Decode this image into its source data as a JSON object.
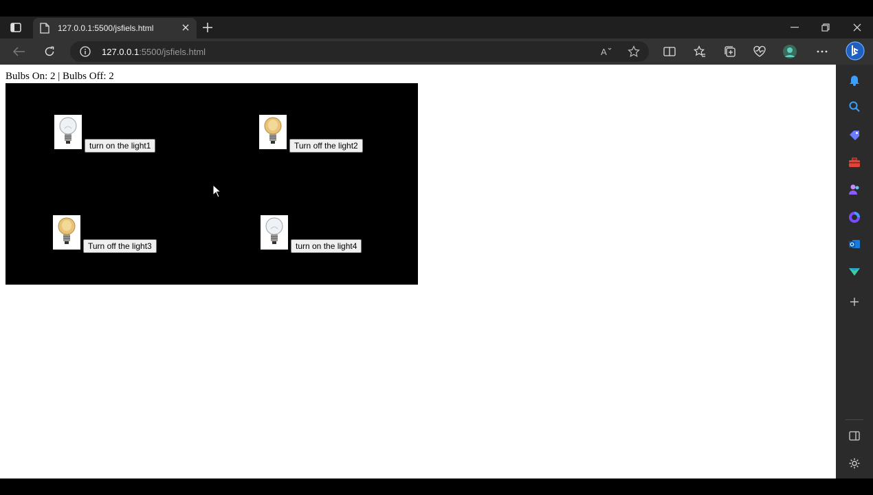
{
  "browser": {
    "tab_title": "127.0.0.1:5500/jsfiels.html",
    "url_host": "127.0.0.1",
    "url_rest": ":5500/jsfiels.html",
    "icons": {
      "tab_actions": "tab-actions-icon",
      "new_tab": "plus-icon",
      "back": "back-arrow-icon",
      "refresh": "refresh-icon",
      "site_info": "info-icon",
      "read_aloud": "read-aloud-icon",
      "favorite": "star-icon",
      "split_screen": "split-screen-icon",
      "favorites": "favorites-icon",
      "collections": "collections-icon",
      "health": "health-icon",
      "profile": "profile-avatar-icon",
      "more": "more-icon",
      "copilot": "bing-icon"
    },
    "sidebar_icons": [
      "bell-icon",
      "search-icon",
      "tag-icon",
      "toolbox-icon",
      "people-icon",
      "circle-app-icon",
      "outlook-icon",
      "send-icon",
      "plus-icon",
      "sidebar-toggle-icon",
      "gear-icon"
    ],
    "accent": "#2b7fd9"
  },
  "page": {
    "status": "Bulbs On: 2 | Bulbs Off: 2",
    "bulbs": [
      {
        "id": 1,
        "state": "off",
        "button_label": "turn on the light1"
      },
      {
        "id": 2,
        "state": "on",
        "button_label": "Turn off the light2"
      },
      {
        "id": 3,
        "state": "on",
        "button_label": "Turn off the light3"
      },
      {
        "id": 4,
        "state": "off",
        "button_label": "turn on the light4"
      }
    ],
    "colors": {
      "stage_bg": "#000000",
      "bulb_on": "#e8b85a",
      "bulb_off": "#e9eef2"
    }
  }
}
